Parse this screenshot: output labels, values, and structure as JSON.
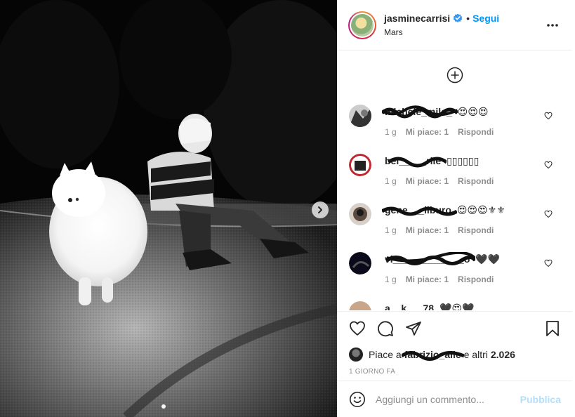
{
  "post": {
    "username": "jasminecarrisi",
    "separator": "•",
    "follow_label": "Segui",
    "location": "Mars",
    "colors": {
      "accent": "#0095f6",
      "publish_disabled": "#b2dffc",
      "muted": "#8e8e8e",
      "text": "#262626"
    }
  },
  "comments": [
    {
      "user": "michele_mile_",
      "text": "😍😍😍",
      "time": "1 g",
      "likes": "Mi piace: 1",
      "reply": "Rispondi"
    },
    {
      "user": "bel_____rile",
      "text": "▯▯▯▯▯▯",
      "time": "1 g",
      "likes": "Mi piace: 1",
      "reply": "Rispondi"
    },
    {
      "user": "gene___ilburo",
      "text": "😍😍😍⚜⚜",
      "time": "1 g",
      "likes": "Mi piace: 1",
      "reply": "Rispondi"
    },
    {
      "user": "vi_____________o",
      "text": "🖤🖤",
      "time": "1 g",
      "likes": "Mi piace: 1",
      "reply": "Rispondi"
    },
    {
      "user": "a__k___78",
      "text": "🖤😍🖤",
      "time": "",
      "likes": "",
      "reply": ""
    }
  ],
  "likes_line": {
    "prefix": "Piace a",
    "user": "fabrizio_alle",
    "suffix": "e altri",
    "count": "2.026"
  },
  "timestamp": "1 GIORNO FA",
  "add_comment": {
    "placeholder": "Aggiungi un commento...",
    "publish_label": "Pubblica"
  },
  "icons": [
    "verified-badge-icon",
    "more-options-icon",
    "plus-circle-icon",
    "heart-icon",
    "comment-icon",
    "share-icon",
    "bookmark-icon",
    "emoji-icon",
    "chevron-right-icon"
  ],
  "carousel": {
    "current": 1,
    "count": 1
  }
}
